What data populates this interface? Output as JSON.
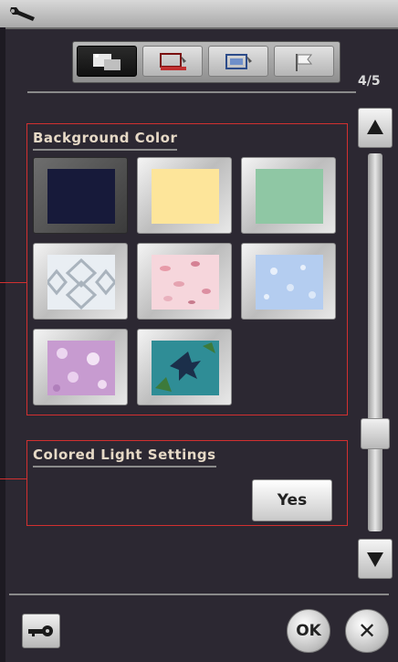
{
  "tabs": [
    {
      "name": "tab-screen-settings",
      "icon": "screen-settings-icon",
      "active": true
    },
    {
      "name": "tab-sewing-settings",
      "icon": "sewing-settings-icon",
      "active": false
    },
    {
      "name": "tab-embroidery-settings",
      "icon": "embroidery-settings-icon",
      "active": false
    },
    {
      "name": "tab-language-settings",
      "icon": "flag-icon",
      "active": false
    }
  ],
  "page_indicator": "4/5",
  "background_color": {
    "title": "Background Color",
    "swatches": [
      {
        "name": "swatch-navy",
        "kind": "solid",
        "color": "#171a3a",
        "selected": true
      },
      {
        "name": "swatch-yellow",
        "kind": "solid",
        "color": "#fde59a",
        "selected": false
      },
      {
        "name": "swatch-green",
        "kind": "solid",
        "color": "#8fc7a4",
        "selected": false
      },
      {
        "name": "swatch-white-pattern",
        "kind": "pattern",
        "color": "#e9eef3",
        "selected": false
      },
      {
        "name": "swatch-pink-petals",
        "kind": "pattern",
        "color": "#f6d6dc",
        "selected": false
      },
      {
        "name": "swatch-blue-snowflakes",
        "kind": "pattern",
        "color": "#b4cdf0",
        "selected": false
      },
      {
        "name": "swatch-purple-flowers",
        "kind": "pattern",
        "color": "#c79bd0",
        "selected": false
      },
      {
        "name": "swatch-teal-leaves",
        "kind": "pattern",
        "color": "#2f8d96",
        "selected": false
      }
    ]
  },
  "colored_light": {
    "title": "Colored Light Settings",
    "button_label": "Yes"
  },
  "buttons": {
    "ok_label": "OK",
    "cancel_label": "✕"
  },
  "scroll": {
    "up_icon": "arrow-up-icon",
    "down_icon": "arrow-down-icon",
    "position": 0.8
  },
  "colors": {
    "accent_red": "#d23030",
    "screen_bg": "#2c2832"
  }
}
